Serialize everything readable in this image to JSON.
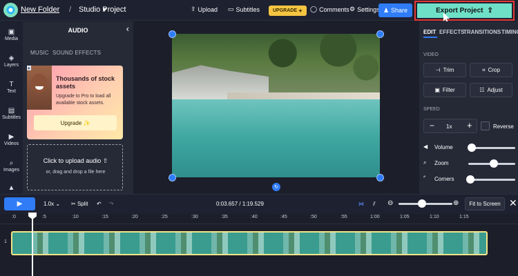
{
  "topbar": {
    "folder": "New Folder",
    "separator": "/",
    "project": "Studio Project",
    "upload": "Upload",
    "subtitles": "Subtitles",
    "upgrade": "UPGRADE",
    "comments": "Comments",
    "settings": "Settings",
    "share": "Share",
    "export": "Export Project"
  },
  "rail": [
    "Media",
    "Layers",
    "Text",
    "Subtitles",
    "Videos",
    "Images"
  ],
  "audio_panel": {
    "title": "AUDIO",
    "tabs": [
      "MUSIC",
      "SOUND EFFECTS"
    ],
    "promo_title": "Thousands of stock assets",
    "promo_text": "Upgrade to Pro to load all available stock assets.",
    "promo_button": "Upgrade ✨",
    "upload_title": "Click to upload audio",
    "upload_sub": "or, drag and drop a file here"
  },
  "right_panel": {
    "tabs": [
      "EDIT",
      "EFFECTS",
      "TRANSITIONS",
      "TIMING"
    ],
    "video_label": "VIDEO",
    "trim": "Trim",
    "crop": "Crop",
    "filter": "Filter",
    "adjust": "Adjust",
    "speed_label": "SPEED",
    "speed_value": "1x",
    "reverse": "Reverse",
    "volume": "Volume",
    "zoom": "Zoom",
    "corners": "Corners",
    "volume_level": 0.08,
    "zoom_level": 0.55,
    "corners_level": 0.05
  },
  "timeline": {
    "speed": "1.0x",
    "split": "Split",
    "current_time": "0:03.657",
    "total_time": "1:19.529",
    "time_separator": " / ",
    "fit_to_screen": "Fit to Screen",
    "track_number": "1",
    "ruler": [
      ":0",
      ":5",
      ":10",
      ":15",
      ":20",
      ":25",
      ":30",
      ":35",
      ":40",
      ":45",
      ":50",
      ":55",
      "1:00",
      "1:05",
      "1:10",
      "1:15"
    ]
  },
  "colors": {
    "accent": "#2f7cf6",
    "export": "#6fe0c8",
    "upgrade": "#f5c542",
    "highlight": "#e53935"
  }
}
